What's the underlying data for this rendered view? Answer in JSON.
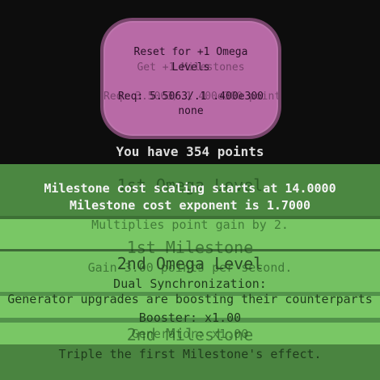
{
  "reset_button": {
    "line1": "Reset for +1 Omega",
    "line1_ghost": "Get +1 Milestones",
    "line2": "Levels",
    "line3": "Req: 5.5063/.1 .400e300",
    "line3_ghost": "Req: 3.5063/.1 400e300 points",
    "line4": "none"
  },
  "points": {
    "text": "You have 354 points"
  },
  "milestone_info": {
    "scaling_text": "Milestone cost scaling starts at 14.0000",
    "exponent_text": "Milestone cost exponent is 1.7000"
  },
  "milestones": {
    "ghost_title_1": "1st Omega Level",
    "ghost_desc_1": "Multiplies point gain by 2.",
    "m1_title": "1st Milestone",
    "m1_desc": "Gain 3.00 points per second.",
    "omega2_title": "2nd Omega Level",
    "omega2_desc": "Dual Synchronization:",
    "omega2_effect": "Generator upgrades are boosting their counterparts",
    "booster_text": "Booster: x1.00",
    "generator_text": "Generator: x1.00",
    "m2_title": "2nd Milestone",
    "m2_desc": "Triple the first Milestone's effect."
  }
}
